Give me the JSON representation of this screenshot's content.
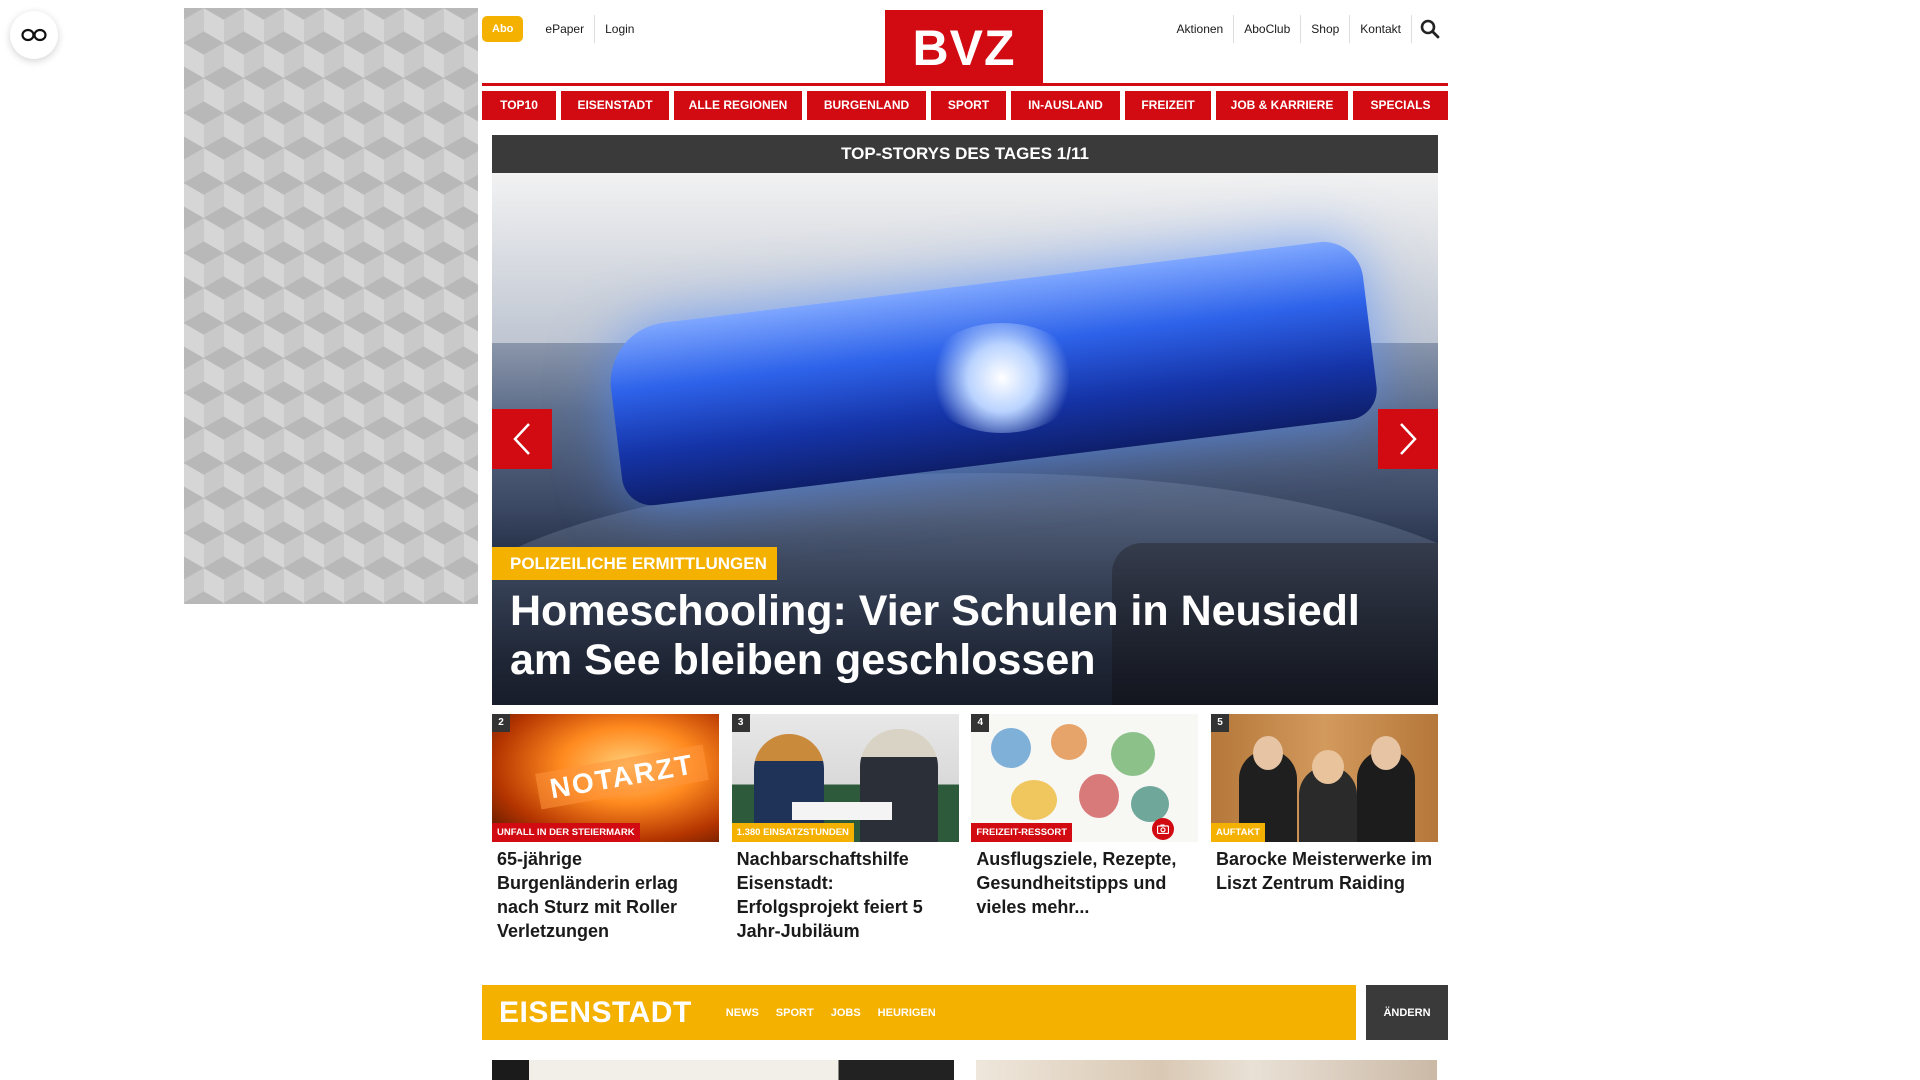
{
  "header": {
    "abo_label": "Abo",
    "top_links_left": [
      "ePaper",
      "Login"
    ],
    "logo_text": "BVZ",
    "top_links_right": [
      "Aktionen",
      "AboClub",
      "Shop",
      "Kontakt"
    ],
    "search_icon": "search-icon"
  },
  "nav": {
    "items": [
      "TOP10",
      "EISENSTADT",
      "ALLE REGIONEN",
      "BURGENLAND",
      "SPORT",
      "IN-AUSLAND",
      "FREIZEIT",
      "JOB & KARRIERE",
      "SPECIALS"
    ]
  },
  "slider": {
    "header": "TOP-STORYS DES TAGES 1/11",
    "hero_tag": "POLIZEILICHE ERMITTLUNGEN",
    "hero_title": "Homeschooling: Vier Schulen in Neusiedl am See bleiben geschlossen",
    "prev_icon": "chevron-left-icon",
    "next_icon": "chevron-right-icon"
  },
  "cards": [
    {
      "num": "2",
      "tag": "UNFALL IN DER STEIERMARK",
      "title": "65-jährige Burgenländerin erlag nach Sturz mit Roller Verletzungen",
      "sign_text": "NOTARZT"
    },
    {
      "num": "3",
      "tag": "1.380 EINSATZSTUNDEN",
      "title": "Nachbarschaftshilfe Eisenstadt: Erfolgsprojekt feiert 5 Jahr-Jubiläum"
    },
    {
      "num": "4",
      "tag": "FREIZEIT-RESSORT",
      "title": "Ausflugsziele, Rezepte, Gesundheitstipps und vieles mehr..."
    },
    {
      "num": "5",
      "tag": "AUFTAKT",
      "title": "Barocke Meisterwerke im Liszt Zentrum Raiding"
    }
  ],
  "region": {
    "title": "EISENSTADT",
    "links": [
      "NEWS",
      "SPORT",
      "JOBS",
      "HEURIGEN"
    ],
    "change_label": "ÄNDERN"
  },
  "colors": {
    "brand_red": "#d20a11",
    "accent_yellow": "#f5b100",
    "dark_bar": "#3a3a3a"
  }
}
